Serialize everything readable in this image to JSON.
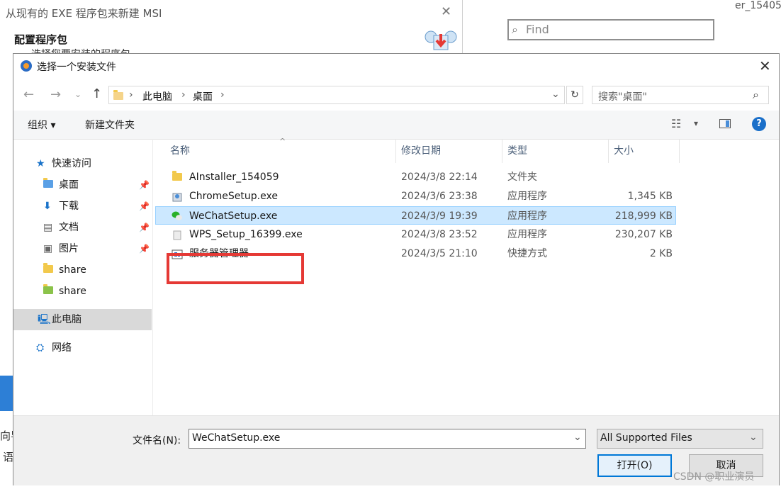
{
  "background_window": {
    "title": "从现有的 EXE 程序包来新建 MSI",
    "section_title": "配置程序包",
    "section_subtitle": "选择您要安装的程序包",
    "find_placeholder": "Find",
    "side_text_1": "向导",
    "side_text_2": "语",
    "far_text": "er_154059"
  },
  "dialog": {
    "title": "选择一个安装文件",
    "breadcrumb": [
      "此电脑",
      "桌面"
    ],
    "search_placeholder": "搜索\"桌面\"",
    "toolbar": {
      "organize": "组织",
      "new_folder": "新建文件夹"
    },
    "nav": {
      "quick_access": "快速访问",
      "items": [
        {
          "label": "桌面",
          "icon": "desktop-icon",
          "pinned": true
        },
        {
          "label": "下载",
          "icon": "download-icon",
          "pinned": true
        },
        {
          "label": "文档",
          "icon": "document-icon",
          "pinned": true
        },
        {
          "label": "图片",
          "icon": "pictures-icon",
          "pinned": true
        },
        {
          "label": "share",
          "icon": "folder-icon",
          "pinned": false
        },
        {
          "label": "share",
          "icon": "share-icon",
          "pinned": false
        }
      ],
      "this_pc": "此电脑",
      "network": "网络"
    },
    "columns": {
      "name": "名称",
      "date": "修改日期",
      "type": "类型",
      "size": "大小"
    },
    "files": [
      {
        "name": "AInstaller_154059",
        "date": "2024/3/8 22:14",
        "type": "文件夹",
        "size": "",
        "icon": "folder-icon"
      },
      {
        "name": "ChromeSetup.exe",
        "date": "2024/3/6 23:38",
        "type": "应用程序",
        "size": "1,345 KB",
        "icon": "installer-icon"
      },
      {
        "name": "WeChatSetup.exe",
        "date": "2024/3/9 19:39",
        "type": "应用程序",
        "size": "218,999 KB",
        "icon": "wechat-icon",
        "selected": true
      },
      {
        "name": "WPS_Setup_16399.exe",
        "date": "2024/3/8 23:52",
        "type": "应用程序",
        "size": "230,207 KB",
        "icon": "wps-icon"
      },
      {
        "name": "服务器管理器",
        "date": "2024/3/5 21:10",
        "type": "快捷方式",
        "size": "2 KB",
        "icon": "server-manager-icon"
      }
    ],
    "filename_label": "文件名(N):",
    "filename_value": "WeChatSetup.exe",
    "filter_value": "All Supported Files",
    "open_button": "打开(O)",
    "cancel_button": "取消"
  },
  "watermark": "CSDN @职业演员",
  "colors": {
    "selection": "#cce8ff",
    "highlight_box": "#e53935",
    "accent": "#0063b1",
    "nav_selected": "#d9d9d9"
  }
}
